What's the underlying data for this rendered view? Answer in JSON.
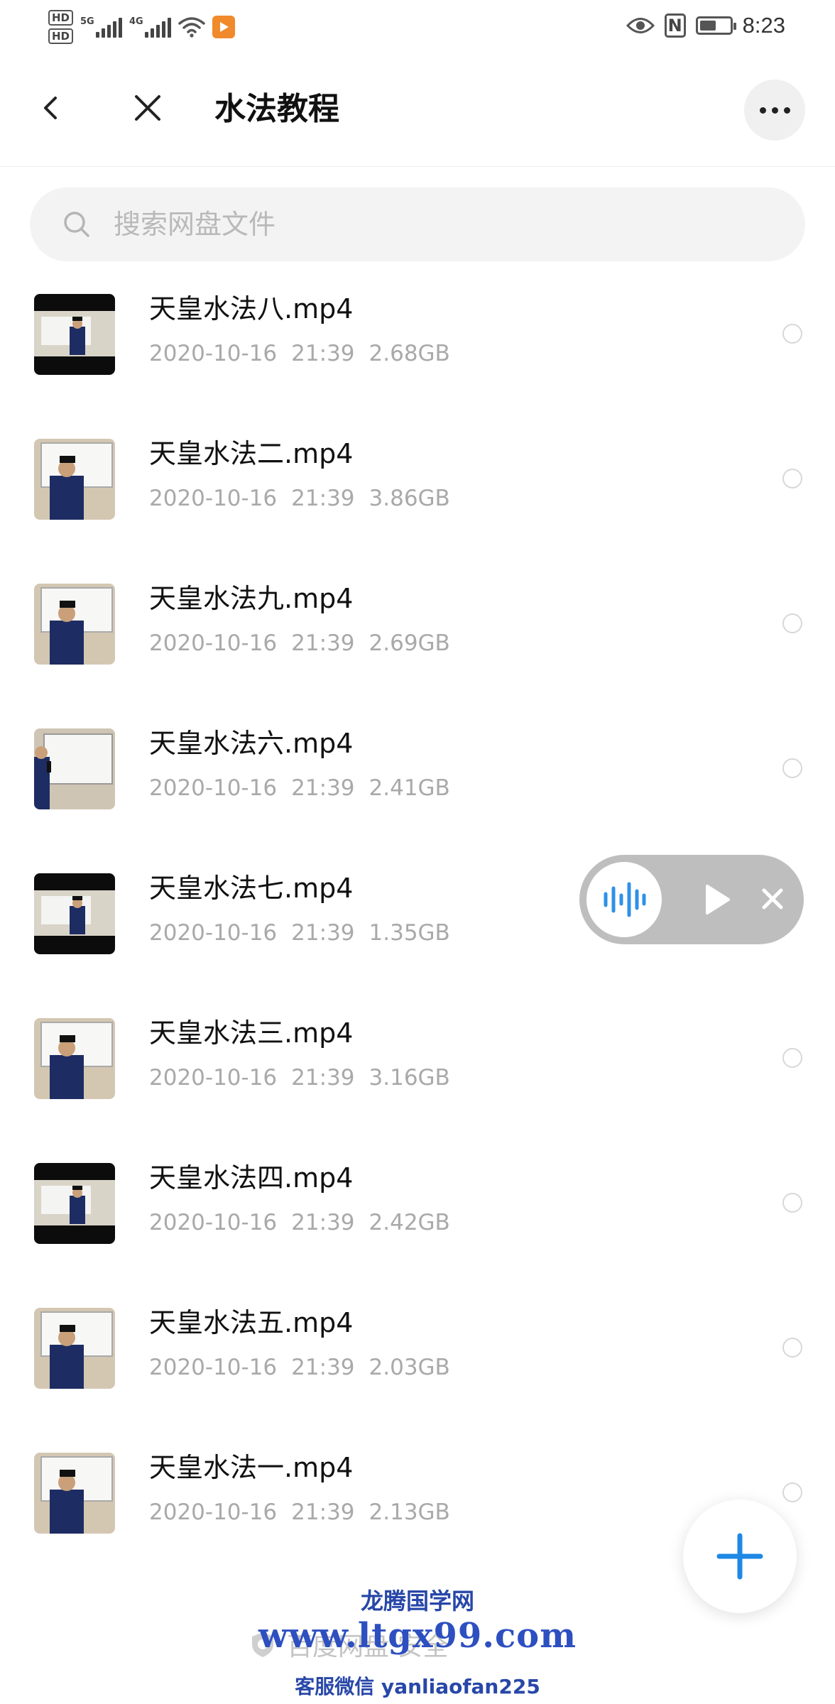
{
  "status_bar": {
    "hd1": "HD",
    "hd2": "HD",
    "net1": "5G",
    "net2": "4G",
    "time": "8:23"
  },
  "header": {
    "title": "水法教程",
    "back_icon": "chevron-left-icon",
    "close_icon": "close-icon",
    "more_icon": "more-dots-icon"
  },
  "search": {
    "placeholder": "搜索网盘文件"
  },
  "files": [
    {
      "name": "天皇水法八.mp4",
      "date": "2020-10-16",
      "time": "21:39",
      "size": "2.68GB",
      "thumb_style": "dark"
    },
    {
      "name": "天皇水法二.mp4",
      "date": "2020-10-16",
      "time": "21:39",
      "size": "3.86GB",
      "thumb_style": "light"
    },
    {
      "name": "天皇水法九.mp4",
      "date": "2020-10-16",
      "time": "21:39",
      "size": "2.69GB",
      "thumb_style": "light"
    },
    {
      "name": "天皇水法六.mp4",
      "date": "2020-10-16",
      "time": "21:39",
      "size": "2.41GB",
      "thumb_style": "board"
    },
    {
      "name": "天皇水法七.mp4",
      "date": "2020-10-16",
      "time": "21:39",
      "size": "1.35GB",
      "thumb_style": "dark"
    },
    {
      "name": "天皇水法三.mp4",
      "date": "2020-10-16",
      "time": "21:39",
      "size": "3.16GB",
      "thumb_style": "light"
    },
    {
      "name": "天皇水法四.mp4",
      "date": "2020-10-16",
      "time": "21:39",
      "size": "2.42GB",
      "thumb_style": "dark"
    },
    {
      "name": "天皇水法五.mp4",
      "date": "2020-10-16",
      "time": "21:39",
      "size": "2.03GB",
      "thumb_style": "light"
    },
    {
      "name": "天皇水法一.mp4",
      "date": "2020-10-16",
      "time": "21:39",
      "size": "2.13GB",
      "thumb_style": "light"
    }
  ],
  "floating_player": {
    "wave_icon": "audio-wave-icon",
    "play_icon": "play-icon",
    "close_icon": "close-icon"
  },
  "fab": {
    "icon": "plus-icon"
  },
  "footer": {
    "note": "百度网盘  安全"
  },
  "watermark": {
    "line1": "龙腾国学网",
    "line2": "www.ltgx99.com",
    "line3": "客服微信 yanliaofan225"
  },
  "colors": {
    "accent": "#1e88e5",
    "muted_text": "#a9a9a9",
    "watermark": "#2d4fc0"
  }
}
